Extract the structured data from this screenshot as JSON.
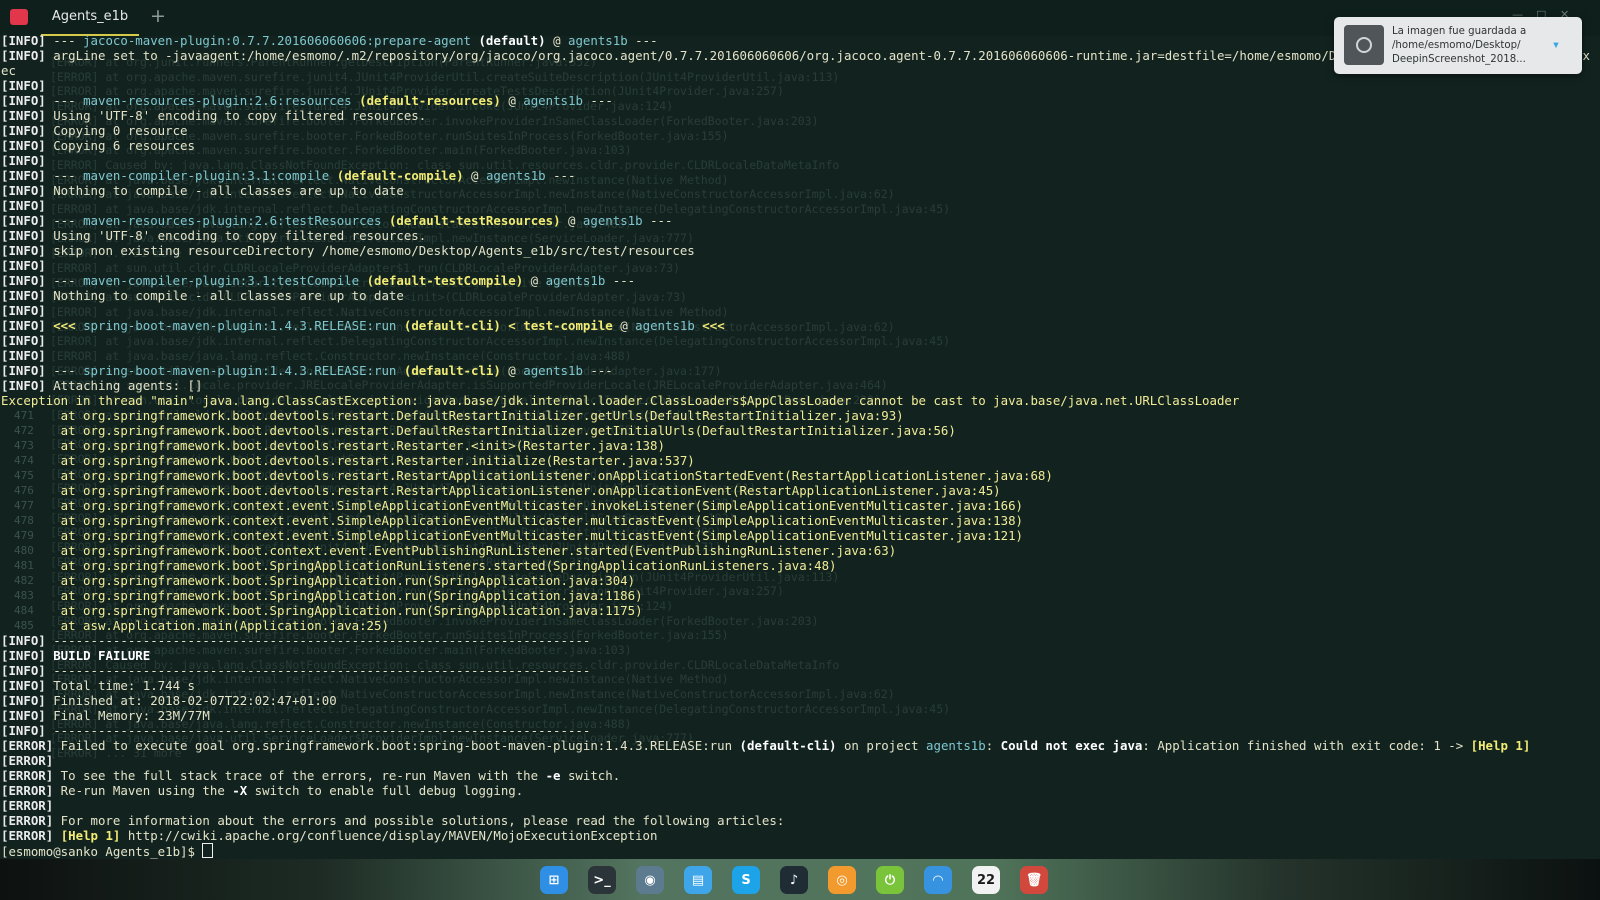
{
  "window": {
    "terminal_icon": "terminal-icon",
    "tab_title": "Agents_e1b",
    "new_tab_symbol": "+",
    "controls": [
      "—",
      "□",
      "✕"
    ]
  },
  "terminal": {
    "background_lines": [
      "[ERROR] at org.junit.runners.ParentRunner.getDescription(ParentRunner.java:352)",
      "[ERROR] at org.apache.maven.surefire.junit4.JUnit4ProviderUtil.createSuiteDescription(JUnit4ProviderUtil.java:113)",
      "[ERROR] at org.apache.maven.surefire.junit4.JUnit4Provider.createTestsDescription(JUnit4Provider.java:257)",
      "[ERROR] at org.apache.maven.surefire.junit4.JUnit4Provider.invoke(JUnit4Provider.java:124)",
      "[ERROR] at org.apache.maven.surefire.booter.ForkedBooter.invokeProviderInSameClassLoader(ForkedBooter.java:203)",
      "[ERROR] at org.apache.maven.surefire.booter.ForkedBooter.runSuitesInProcess(ForkedBooter.java:155)",
      "[ERROR] at org.apache.maven.surefire.booter.ForkedBooter.main(ForkedBooter.java:103)",
      "[ERROR] Caused by: java.lang.ClassNotFoundException: class sun.util.resources.cldr.provider.CLDRLocaleDataMetaInfo",
      "[ERROR] at java.base/jdk.internal.reflect.NativeConstructorAccessorImpl.newInstance(Native Method)",
      "[ERROR] at java.base/jdk.internal.reflect.NativeConstructorAccessorImpl.newInstance(NativeConstructorAccessorImpl.java:62)",
      "[ERROR] at java.base/jdk.internal.reflect.DelegatingConstructorAccessorImpl.newInstance(DelegatingConstructorAccessorImpl.java:45)",
      "[ERROR] at java.base/java.lang.reflect.Constructor.newInstance(Constructor.java:488)",
      "[ERROR] at java.base/java.util.ServiceLoader$ProviderImpl.newInstance(ServiceLoader.java:777)",
      "[ERROR] ... 31 more",
      "[ERROR] at sun.util.cldr.CLDRLocaleProviderAdapter$1.run(CLDRLocaleProviderAdapter.java:73)",
      "[ERROR] at java.base/java.security.AccessController.doPrivileged(Native Method)",
      "[ERROR] at sun.util.cldr.CLDRLocaleProviderAdapter.<init>(CLDRLocaleProviderAdapter.java:73)",
      "[ERROR] at java.base/jdk.internal.reflect.NativeConstructorAccessorImpl.newInstance(Native Method)",
      "[ERROR] at java.base/jdk.internal.reflect.NativeConstructorAccessorImpl.newInstance(NativeConstructorAccessorImpl.java:62)",
      "[ERROR] at java.base/jdk.internal.reflect.DelegatingConstructorAccessorImpl.newInstance(DelegatingConstructorAccessorImpl.java:45)",
      "[ERROR] at java.base/java.lang.reflect.Constructor.newInstance(Constructor.java:488)",
      "[ERROR] at sun.util.locale.provider.LocaleProviderAdapter.forType(LocaleProviderAdapter.java:177)",
      "[ERROR] at sun.util.locale.provider.JRELocaleProviderAdapter.isSupportedProviderLocale(JRELocaleProviderAdapter.java:464)",
      "[ERROR] at sun.util.locale.provider.LocaleServiceProviderPool.getLocalizedObjectImpl(LocaleServiceProviderPool.java:220)",
      "[ERROR] at sun.util.cldr.CLDRLocaleProviderAdapter.getCandidateLocales(CLDRLocaleProviderAdapter.java:250)",
      "[ERROR] at java.base/java.util.ResourceBundle.getBundleImpl(ResourceBundle.java:1655)",
      "[ERROR] at java.base/java.util.Locale.getDisplayName(Locale.java:2042)",
      "[ERROR] at java.base/java.util.Currency.getSymbol(Currency.java:593)",
      "[ERROR] at org.junit.runners.model.FrameworkField.getAnnotations(FrameworkField.java:35)",
      "[ERROR] at org.apache.maven.surefire.common.junit4.JUnit4TestChecker.accept(JUnit4TestChecker.java:51)",
      "[ERROR] at org.apache.maven.surefire.report.ReporterFactory.createReporter(ReportingRunner.java:30)",
      "[ERROR] at org.apache.maven.surefire.util.DefaultScanResult.applyFilter(DefaultScanResult.java:102)",
      "[ERROR] at org.apache.maven.surefire.junit4.JUnit4Provider.scanClassPath(JUnit4Provider.java:309)",
      "[ERROR] at org.apache.maven.surefire.junit4.JUnit4Provider.setTestsToRun(JUnit4Provider.java:171)",
      "[ERROR] at org.junit.runners.ParentRunner.getDescription(ParentRunner.java:352)",
      "[ERROR] at org.apache.maven.surefire.junit4.JUnit4ProviderUtil.createSuiteDescription(JUnit4ProviderUtil.java:113)",
      "[ERROR] at org.apache.maven.surefire.junit4.JUnit4Provider.createTestsDescription(JUnit4Provider.java:257)",
      "[ERROR] at org.apache.maven.surefire.junit4.JUnit4Provider.invoke(JUnit4Provider.java:124)",
      "[ERROR] at org.apache.maven.surefire.booter.ForkedBooter.invokeProviderInSameClassLoader(ForkedBooter.java:203)",
      "[ERROR] at org.apache.maven.surefire.booter.ForkedBooter.runSuitesInProcess(ForkedBooter.java:155)",
      "[ERROR] at org.apache.maven.surefire.booter.ForkedBooter.main(ForkedBooter.java:103)",
      "[ERROR] Caused by: java.lang.ClassNotFoundException: class sun.util.resources.cldr.provider.CLDRLocaleDataMetaInfo",
      "[ERROR] at java.base/jdk.internal.reflect.NativeConstructorAccessorImpl.newInstance(Native Method)",
      "[ERROR] at java.base/jdk.internal.reflect.NativeConstructorAccessorImpl.newInstance(NativeConstructorAccessorImpl.java:62)",
      "[ERROR] at java.base/jdk.internal.reflect.DelegatingConstructorAccessorImpl.newInstance(DelegatingConstructorAccessorImpl.java:45)",
      "[ERROR] at java.base/java.lang.reflect.Constructor.newInstance(Constructor.java:488)",
      "[ERROR] at java.base/java.util.ServiceLoader$ProviderImpl.newInstance(ServiceLoader.java:777)",
      "[ERROR] ... 31 more"
    ],
    "gutter_numbers": [
      "471",
      "472",
      "473",
      "474",
      "475",
      "476",
      "477",
      "478",
      "479",
      "480",
      "481",
      "482",
      "483",
      "484",
      "485"
    ],
    "lines": [
      [
        [
          "[INFO]",
          "info"
        ],
        [
          " --- ",
          "pale"
        ],
        [
          "jacoco-maven-plugin:0.7.7.201606060606:prepare-agent",
          "cy"
        ],
        [
          " ",
          ""
        ],
        [
          "(default)",
          "wb"
        ],
        [
          " @ ",
          "pale"
        ],
        [
          "agents1b",
          "cy"
        ],
        [
          " ---",
          "pale"
        ]
      ],
      [
        [
          "[INFO]",
          "info"
        ],
        [
          " argLine set to -javaagent:/home/esmomo/.m2/repository/org/jacoco/org.jacoco.agent/0.7.7.201606060606/org.jacoco.agent-0.7.7.201606060606-runtime.jar=destfile=/home/esmomo/Desktop/Agents_e1b/target/jacoco.ex",
          "pale"
        ]
      ],
      [
        [
          "ec",
          "pale"
        ]
      ],
      [
        [
          "[INFO]",
          "info"
        ]
      ],
      [
        [
          "[INFO]",
          "info"
        ],
        [
          " --- ",
          "pale"
        ],
        [
          "maven-resources-plugin:2.6:resources",
          "cy"
        ],
        [
          " ",
          ""
        ],
        [
          "(default-resources)",
          "yb"
        ],
        [
          " @ ",
          "pale"
        ],
        [
          "agents1b",
          "cy"
        ],
        [
          " ---",
          "pale"
        ]
      ],
      [
        [
          "[INFO]",
          "info"
        ],
        [
          " Using 'UTF-8' encoding to copy filtered resources.",
          "pale"
        ]
      ],
      [
        [
          "[INFO]",
          "info"
        ],
        [
          " Copying 0 resource",
          "pale"
        ]
      ],
      [
        [
          "[INFO]",
          "info"
        ],
        [
          " Copying 6 resources",
          "pale"
        ]
      ],
      [
        [
          "[INFO]",
          "info"
        ]
      ],
      [
        [
          "[INFO]",
          "info"
        ],
        [
          " --- ",
          "pale"
        ],
        [
          "maven-compiler-plugin:3.1:compile",
          "cy"
        ],
        [
          " ",
          ""
        ],
        [
          "(default-compile)",
          "yb"
        ],
        [
          " @ ",
          "pale"
        ],
        [
          "agents1b",
          "cy"
        ],
        [
          " ---",
          "pale"
        ]
      ],
      [
        [
          "[INFO]",
          "info"
        ],
        [
          " Nothing to compile - all classes are up to date",
          "pale"
        ]
      ],
      [
        [
          "[INFO]",
          "info"
        ]
      ],
      [
        [
          "[INFO]",
          "info"
        ],
        [
          " --- ",
          "pale"
        ],
        [
          "maven-resources-plugin:2.6:testResources",
          "cy"
        ],
        [
          " ",
          ""
        ],
        [
          "(default-testResources)",
          "yb"
        ],
        [
          " @ ",
          "pale"
        ],
        [
          "agents1b",
          "cy"
        ],
        [
          " ---",
          "pale"
        ]
      ],
      [
        [
          "[INFO]",
          "info"
        ],
        [
          " Using 'UTF-8' encoding to copy filtered resources.",
          "pale"
        ]
      ],
      [
        [
          "[INFO]",
          "info"
        ],
        [
          " skip non existing resourceDirectory /home/esmomo/Desktop/Agents_e1b/src/test/resources",
          "pale"
        ]
      ],
      [
        [
          "[INFO]",
          "info"
        ]
      ],
      [
        [
          "[INFO]",
          "info"
        ],
        [
          " --- ",
          "pale"
        ],
        [
          "maven-compiler-plugin:3.1:testCompile",
          "cy"
        ],
        [
          " ",
          ""
        ],
        [
          "(default-testCompile)",
          "yb"
        ],
        [
          " @ ",
          "pale"
        ],
        [
          "agents1b",
          "cy"
        ],
        [
          " ---",
          "pale"
        ]
      ],
      [
        [
          "[INFO]",
          "info"
        ],
        [
          " Nothing to compile - all classes are up to date",
          "pale"
        ]
      ],
      [
        [
          "[INFO]",
          "info"
        ]
      ],
      [
        [
          "[INFO]",
          "info"
        ],
        [
          " <<< ",
          "yb"
        ],
        [
          "spring-boot-maven-plugin:1.4.3.RELEASE:run",
          "cy"
        ],
        [
          " ",
          ""
        ],
        [
          "(default-cli)",
          "yb"
        ],
        [
          " < ",
          "yb"
        ],
        [
          "test-compile",
          "yb"
        ],
        [
          " @ ",
          "pale"
        ],
        [
          "agents1b",
          "cy"
        ],
        [
          " <<<",
          "yb"
        ]
      ],
      [
        [
          "[INFO]",
          "info"
        ]
      ],
      [
        [
          "[INFO]",
          "info"
        ]
      ],
      [
        [
          "[INFO]",
          "info"
        ],
        [
          " --- ",
          "pale"
        ],
        [
          "spring-boot-maven-plugin:1.4.3.RELEASE:run",
          "cy"
        ],
        [
          " ",
          ""
        ],
        [
          "(default-cli)",
          "yb"
        ],
        [
          " @ ",
          "pale"
        ],
        [
          "agents1b",
          "cy"
        ],
        [
          " ---",
          "pale"
        ]
      ],
      [
        [
          "[INFO]",
          "info"
        ],
        [
          " Attaching agents: []",
          "pale"
        ]
      ],
      [
        [
          "Exception in thread \"main\" java.lang.ClassCastException: java.base/jdk.internal.loader.ClassLoaders$AppClassLoader cannot be cast to java.base/java.net.URLClassLoader",
          "exc"
        ]
      ],
      [
        [
          "        at org.springframework.boot.devtools.restart.DefaultRestartInitializer.getUrls(DefaultRestartInitializer.java:93)",
          "exc"
        ]
      ],
      [
        [
          "        at org.springframework.boot.devtools.restart.DefaultRestartInitializer.getInitialUrls(DefaultRestartInitializer.java:56)",
          "exc"
        ]
      ],
      [
        [
          "        at org.springframework.boot.devtools.restart.Restarter.<init>(Restarter.java:138)",
          "exc"
        ]
      ],
      [
        [
          "        at org.springframework.boot.devtools.restart.Restarter.initialize(Restarter.java:537)",
          "exc"
        ]
      ],
      [
        [
          "        at org.springframework.boot.devtools.restart.RestartApplicationListener.onApplicationStartedEvent(RestartApplicationListener.java:68)",
          "exc"
        ]
      ],
      [
        [
          "        at org.springframework.boot.devtools.restart.RestartApplicationListener.onApplicationEvent(RestartApplicationListener.java:45)",
          "exc"
        ]
      ],
      [
        [
          "        at org.springframework.context.event.SimpleApplicationEventMulticaster.invokeListener(SimpleApplicationEventMulticaster.java:166)",
          "exc"
        ]
      ],
      [
        [
          "        at org.springframework.context.event.SimpleApplicationEventMulticaster.multicastEvent(SimpleApplicationEventMulticaster.java:138)",
          "exc"
        ]
      ],
      [
        [
          "        at org.springframework.context.event.SimpleApplicationEventMulticaster.multicastEvent(SimpleApplicationEventMulticaster.java:121)",
          "exc"
        ]
      ],
      [
        [
          "        at org.springframework.boot.context.event.EventPublishingRunListener.started(EventPublishingRunListener.java:63)",
          "exc"
        ]
      ],
      [
        [
          "        at org.springframework.boot.SpringApplicationRunListeners.started(SpringApplicationRunListeners.java:48)",
          "exc"
        ]
      ],
      [
        [
          "        at org.springframework.boot.SpringApplication.run(SpringApplication.java:304)",
          "exc"
        ]
      ],
      [
        [
          "        at org.springframework.boot.SpringApplication.run(SpringApplication.java:1186)",
          "exc"
        ]
      ],
      [
        [
          "        at org.springframework.boot.SpringApplication.run(SpringApplication.java:1175)",
          "exc"
        ]
      ],
      [
        [
          "        at asw.Application.main(Application.java:25)",
          "exc"
        ]
      ],
      [
        [
          "[INFO]",
          "info"
        ],
        [
          " ------------------------------------------------------------------------",
          "pale"
        ]
      ],
      [
        [
          "[INFO]",
          "info"
        ],
        [
          " BUILD FAILURE",
          "wb"
        ]
      ],
      [
        [
          "[INFO]",
          "info"
        ],
        [
          " ------------------------------------------------------------------------",
          "pale"
        ]
      ],
      [
        [
          "[INFO]",
          "info"
        ],
        [
          " Total time: 1.744 s",
          "pale"
        ]
      ],
      [
        [
          "[INFO]",
          "info"
        ],
        [
          " Finished at: 2018-02-07T22:02:47+01:00",
          "pale"
        ]
      ],
      [
        [
          "[INFO]",
          "info"
        ],
        [
          " Final Memory: 23M/77M",
          "pale"
        ]
      ],
      [
        [
          "[INFO]",
          "info"
        ],
        [
          " ------------------------------------------------------------------------",
          "pale"
        ]
      ],
      [
        [
          "[ERROR]",
          "err"
        ],
        [
          " Failed to execute goal org.springframework.boot:spring-boot-maven-plugin:1.4.3.RELEASE:run ",
          "pale"
        ],
        [
          "(default-cli)",
          "wb"
        ],
        [
          " on project ",
          "pale"
        ],
        [
          "agents1b",
          "cy"
        ],
        [
          ": ",
          "pale"
        ],
        [
          "Could not exec java",
          "wb"
        ],
        [
          ": Application finished with exit code: 1 -> ",
          "pale"
        ],
        [
          "[Help 1]",
          "yb"
        ]
      ],
      [
        [
          "[ERROR]",
          "err"
        ]
      ],
      [
        [
          "[ERROR]",
          "err"
        ],
        [
          " To see the full stack trace of the errors, re-run Maven with the ",
          "pale"
        ],
        [
          "-e",
          "wb"
        ],
        [
          " switch.",
          "pale"
        ]
      ],
      [
        [
          "[ERROR]",
          "err"
        ],
        [
          " Re-run Maven using the ",
          "pale"
        ],
        [
          "-X",
          "wb"
        ],
        [
          " switch to enable full debug logging.",
          "pale"
        ]
      ],
      [
        [
          "[ERROR]",
          "err"
        ]
      ],
      [
        [
          "[ERROR]",
          "err"
        ],
        [
          " For more information about the errors and possible solutions, please read the following articles:",
          "pale"
        ]
      ],
      [
        [
          "[ERROR]",
          "err"
        ],
        [
          " ",
          ""
        ],
        [
          "[Help 1]",
          "yb"
        ],
        [
          " http://cwiki.apache.org/confluence/display/MAVEN/MojoExecutionException",
          "pale"
        ]
      ]
    ],
    "prompt": "[esmomo@sanko Agents_e1b]$ "
  },
  "notification": {
    "icon": "screenshot-icon",
    "text": "La imagen fue guardada a /home/esmomo/Desktop/ DeepinScreenshot_2018...",
    "action_icon": "chevron-down-icon"
  },
  "dock": {
    "items": [
      {
        "name": "launcher-icon",
        "glyph": "⊞",
        "color": "#2f8fe5"
      },
      {
        "name": "terminal-icon",
        "glyph": ">_",
        "color": "#2b3438"
      },
      {
        "name": "chrome-icon",
        "glyph": "◉",
        "color": "#5d7b8e"
      },
      {
        "name": "files-icon",
        "glyph": "▤",
        "color": "#3ea6e8"
      },
      {
        "name": "skype-icon",
        "glyph": "S",
        "color": "#1da3e7"
      },
      {
        "name": "music-icon",
        "glyph": "♪",
        "color": "#1f2c34"
      },
      {
        "name": "deepin-store-icon",
        "glyph": "◎",
        "color": "#f39a2e"
      },
      {
        "name": "power-icon",
        "glyph": "⏻",
        "color": "#79c43b"
      },
      {
        "name": "wifi-icon",
        "glyph": "◠",
        "color": "#3793df"
      },
      {
        "name": "clock-icon",
        "glyph": "22",
        "color": "#f2f2f2"
      },
      {
        "name": "trash-icon",
        "glyph": "🗑",
        "color": "#d3483d"
      }
    ]
  }
}
